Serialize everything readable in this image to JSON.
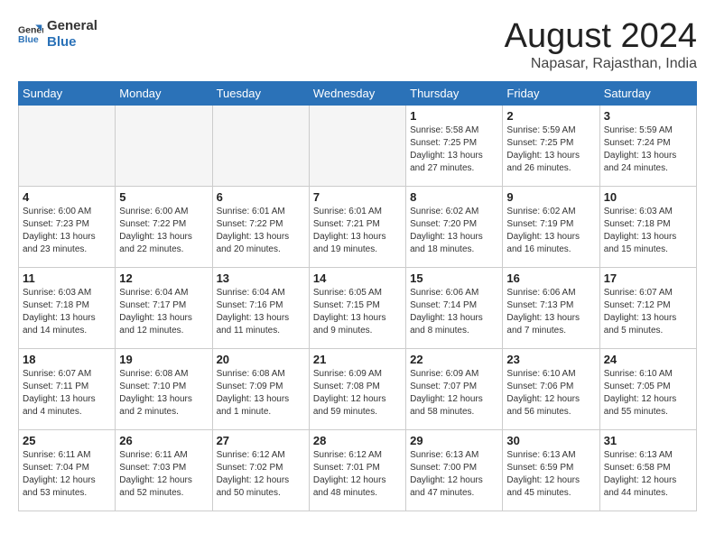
{
  "header": {
    "logo_line1": "General",
    "logo_line2": "Blue",
    "main_title": "August 2024",
    "subtitle": "Napasar, Rajasthan, India"
  },
  "weekdays": [
    "Sunday",
    "Monday",
    "Tuesday",
    "Wednesday",
    "Thursday",
    "Friday",
    "Saturday"
  ],
  "weeks": [
    [
      {
        "day": "",
        "empty": true
      },
      {
        "day": "",
        "empty": true
      },
      {
        "day": "",
        "empty": true
      },
      {
        "day": "",
        "empty": true
      },
      {
        "day": "1",
        "sunrise": "5:58 AM",
        "sunset": "7:25 PM",
        "daylight": "13 hours and 27 minutes."
      },
      {
        "day": "2",
        "sunrise": "5:59 AM",
        "sunset": "7:25 PM",
        "daylight": "13 hours and 26 minutes."
      },
      {
        "day": "3",
        "sunrise": "5:59 AM",
        "sunset": "7:24 PM",
        "daylight": "13 hours and 24 minutes."
      }
    ],
    [
      {
        "day": "4",
        "sunrise": "6:00 AM",
        "sunset": "7:23 PM",
        "daylight": "13 hours and 23 minutes."
      },
      {
        "day": "5",
        "sunrise": "6:00 AM",
        "sunset": "7:22 PM",
        "daylight": "13 hours and 22 minutes."
      },
      {
        "day": "6",
        "sunrise": "6:01 AM",
        "sunset": "7:22 PM",
        "daylight": "13 hours and 20 minutes."
      },
      {
        "day": "7",
        "sunrise": "6:01 AM",
        "sunset": "7:21 PM",
        "daylight": "13 hours and 19 minutes."
      },
      {
        "day": "8",
        "sunrise": "6:02 AM",
        "sunset": "7:20 PM",
        "daylight": "13 hours and 18 minutes."
      },
      {
        "day": "9",
        "sunrise": "6:02 AM",
        "sunset": "7:19 PM",
        "daylight": "13 hours and 16 minutes."
      },
      {
        "day": "10",
        "sunrise": "6:03 AM",
        "sunset": "7:18 PM",
        "daylight": "13 hours and 15 minutes."
      }
    ],
    [
      {
        "day": "11",
        "sunrise": "6:03 AM",
        "sunset": "7:18 PM",
        "daylight": "13 hours and 14 minutes."
      },
      {
        "day": "12",
        "sunrise": "6:04 AM",
        "sunset": "7:17 PM",
        "daylight": "13 hours and 12 minutes."
      },
      {
        "day": "13",
        "sunrise": "6:04 AM",
        "sunset": "7:16 PM",
        "daylight": "13 hours and 11 minutes."
      },
      {
        "day": "14",
        "sunrise": "6:05 AM",
        "sunset": "7:15 PM",
        "daylight": "13 hours and 9 minutes."
      },
      {
        "day": "15",
        "sunrise": "6:06 AM",
        "sunset": "7:14 PM",
        "daylight": "13 hours and 8 minutes."
      },
      {
        "day": "16",
        "sunrise": "6:06 AM",
        "sunset": "7:13 PM",
        "daylight": "13 hours and 7 minutes."
      },
      {
        "day": "17",
        "sunrise": "6:07 AM",
        "sunset": "7:12 PM",
        "daylight": "13 hours and 5 minutes."
      }
    ],
    [
      {
        "day": "18",
        "sunrise": "6:07 AM",
        "sunset": "7:11 PM",
        "daylight": "13 hours and 4 minutes."
      },
      {
        "day": "19",
        "sunrise": "6:08 AM",
        "sunset": "7:10 PM",
        "daylight": "13 hours and 2 minutes."
      },
      {
        "day": "20",
        "sunrise": "6:08 AM",
        "sunset": "7:09 PM",
        "daylight": "13 hours and 1 minute."
      },
      {
        "day": "21",
        "sunrise": "6:09 AM",
        "sunset": "7:08 PM",
        "daylight": "12 hours and 59 minutes."
      },
      {
        "day": "22",
        "sunrise": "6:09 AM",
        "sunset": "7:07 PM",
        "daylight": "12 hours and 58 minutes."
      },
      {
        "day": "23",
        "sunrise": "6:10 AM",
        "sunset": "7:06 PM",
        "daylight": "12 hours and 56 minutes."
      },
      {
        "day": "24",
        "sunrise": "6:10 AM",
        "sunset": "7:05 PM",
        "daylight": "12 hours and 55 minutes."
      }
    ],
    [
      {
        "day": "25",
        "sunrise": "6:11 AM",
        "sunset": "7:04 PM",
        "daylight": "12 hours and 53 minutes."
      },
      {
        "day": "26",
        "sunrise": "6:11 AM",
        "sunset": "7:03 PM",
        "daylight": "12 hours and 52 minutes."
      },
      {
        "day": "27",
        "sunrise": "6:12 AM",
        "sunset": "7:02 PM",
        "daylight": "12 hours and 50 minutes."
      },
      {
        "day": "28",
        "sunrise": "6:12 AM",
        "sunset": "7:01 PM",
        "daylight": "12 hours and 48 minutes."
      },
      {
        "day": "29",
        "sunrise": "6:13 AM",
        "sunset": "7:00 PM",
        "daylight": "12 hours and 47 minutes."
      },
      {
        "day": "30",
        "sunrise": "6:13 AM",
        "sunset": "6:59 PM",
        "daylight": "12 hours and 45 minutes."
      },
      {
        "day": "31",
        "sunrise": "6:13 AM",
        "sunset": "6:58 PM",
        "daylight": "12 hours and 44 minutes."
      }
    ]
  ]
}
